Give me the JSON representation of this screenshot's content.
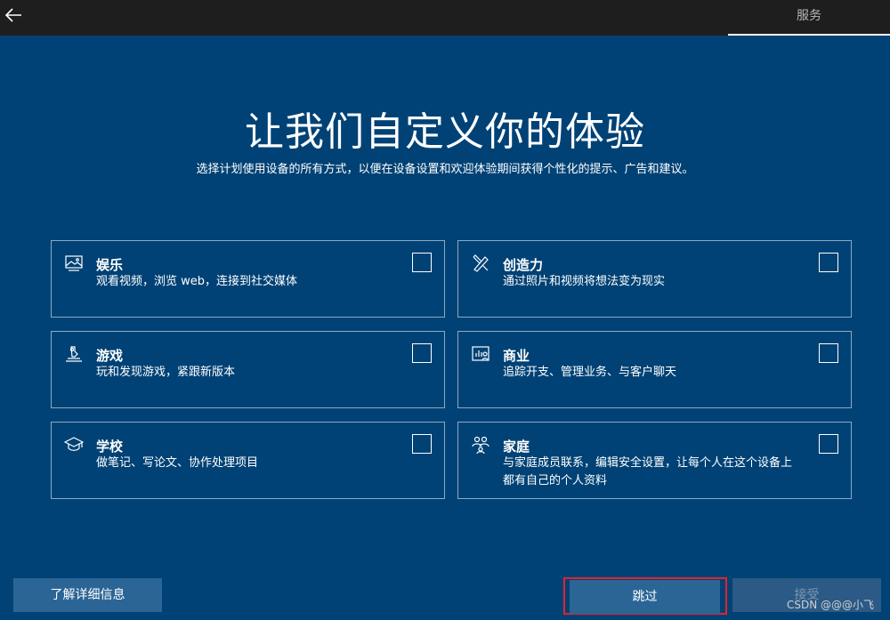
{
  "header": {
    "back_icon": "arrow-left-icon",
    "tab_label": "服务"
  },
  "main": {
    "title": "让我们自定义你的体验",
    "subtitle": "选择计划使用设备的所有方式，以便在设备设置和欢迎体验期间获得个性化的提示、广告和建议。"
  },
  "options": [
    {
      "icon": "entertainment-icon",
      "title": "娱乐",
      "desc": "观看视频，浏览 web，连接到社交媒体",
      "checked": false
    },
    {
      "icon": "creativity-icon",
      "title": "创造力",
      "desc": "通过照片和视频将想法变为现实",
      "checked": false
    },
    {
      "icon": "gaming-icon",
      "title": "游戏",
      "desc": "玩和发现游戏，紧跟新版本",
      "checked": false
    },
    {
      "icon": "business-icon",
      "title": "商业",
      "desc": "追踪开支、管理业务、与客户聊天",
      "checked": false
    },
    {
      "icon": "school-icon",
      "title": "学校",
      "desc": "做笔记、写论文、协作处理项目",
      "checked": false
    },
    {
      "icon": "family-icon",
      "title": "家庭",
      "desc": "与家庭成员联系，编辑安全设置，让每个人在这个设备上都有自己的个人资料",
      "checked": false
    }
  ],
  "footer": {
    "learn_more_label": "了解详细信息",
    "skip_label": "跳过",
    "accept_label": "接受",
    "watermark": "CSDN @@@小飞"
  },
  "colors": {
    "background": "#004275",
    "topbar": "#1e1e1e",
    "button": "#2b6596",
    "highlight": "#e0242c"
  }
}
